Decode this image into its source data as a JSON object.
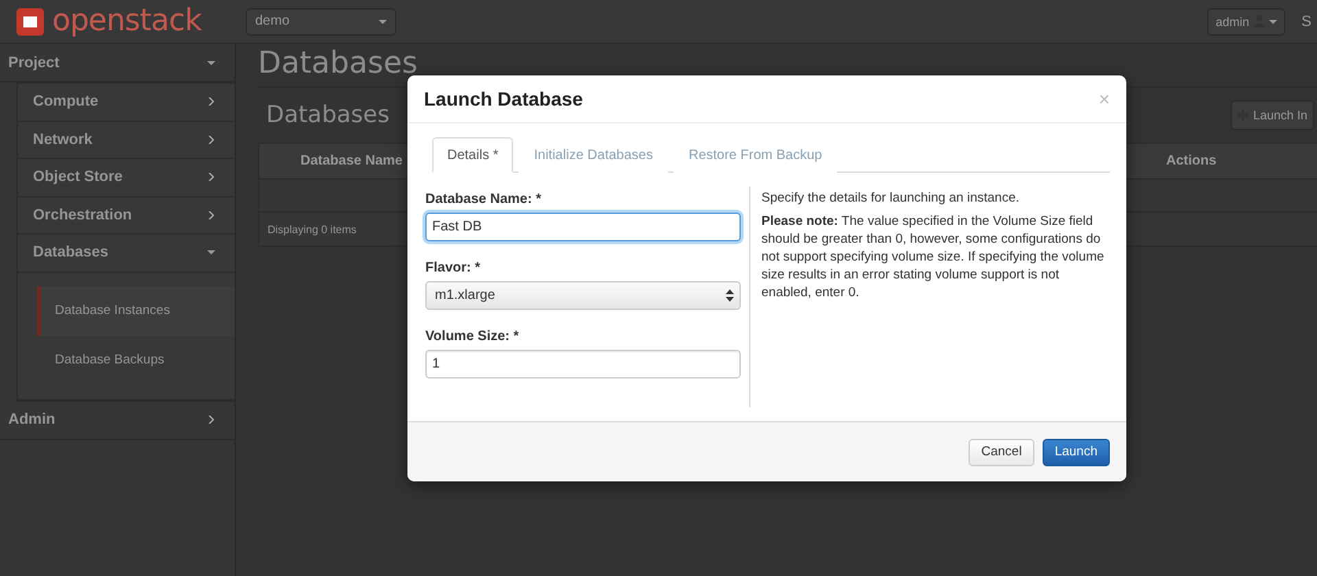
{
  "topbar": {
    "logo": "openstack",
    "project": "demo",
    "user": "admin",
    "edge_text": "S"
  },
  "sidebar": [
    {
      "label": "Project",
      "expanded": true,
      "children": [
        {
          "label": "Compute",
          "expanded": false
        },
        {
          "label": "Network",
          "expanded": false
        },
        {
          "label": "Object Store",
          "expanded": false
        },
        {
          "label": "Orchestration",
          "expanded": false
        },
        {
          "label": "Databases",
          "expanded": true,
          "children": [
            {
              "label": "Database Instances",
              "selected": true
            },
            {
              "label": "Database Backups",
              "selected": false
            }
          ]
        }
      ]
    },
    {
      "label": "Admin",
      "expanded": false
    }
  ],
  "page": {
    "title": "Databases",
    "table_title": "Databases",
    "launch_button": "Launch In",
    "columns": [
      "Database Name",
      "Actions"
    ],
    "footer": "Displaying 0 items"
  },
  "modal": {
    "title": "Launch Database",
    "close": "×",
    "tabs": [
      {
        "label": "Details *",
        "selected": true
      },
      {
        "label": "Initialize Databases",
        "selected": false
      },
      {
        "label": "Restore From Backup",
        "selected": false
      }
    ],
    "fields": [
      {
        "kind": "text",
        "label": "Database Name: *",
        "value": "Fast DB",
        "focused": true
      },
      {
        "kind": "select",
        "label": "Flavor: *",
        "value": "m1.xlarge"
      },
      {
        "kind": "text",
        "label": "Volume Size: *",
        "value": "1",
        "focused": false
      }
    ],
    "help": [
      "Specify the details for launching an instance.",
      "**Please note:** The value specified in the Volume Size field should be greater than 0, however, some configurations do not support specifying volume size. If specifying the volume size results in an error stating volume support is not enabled, enter 0."
    ],
    "buttons": [
      {
        "label": "Cancel",
        "kind": "secondary"
      },
      {
        "label": "Launch",
        "kind": "primary"
      }
    ]
  }
}
